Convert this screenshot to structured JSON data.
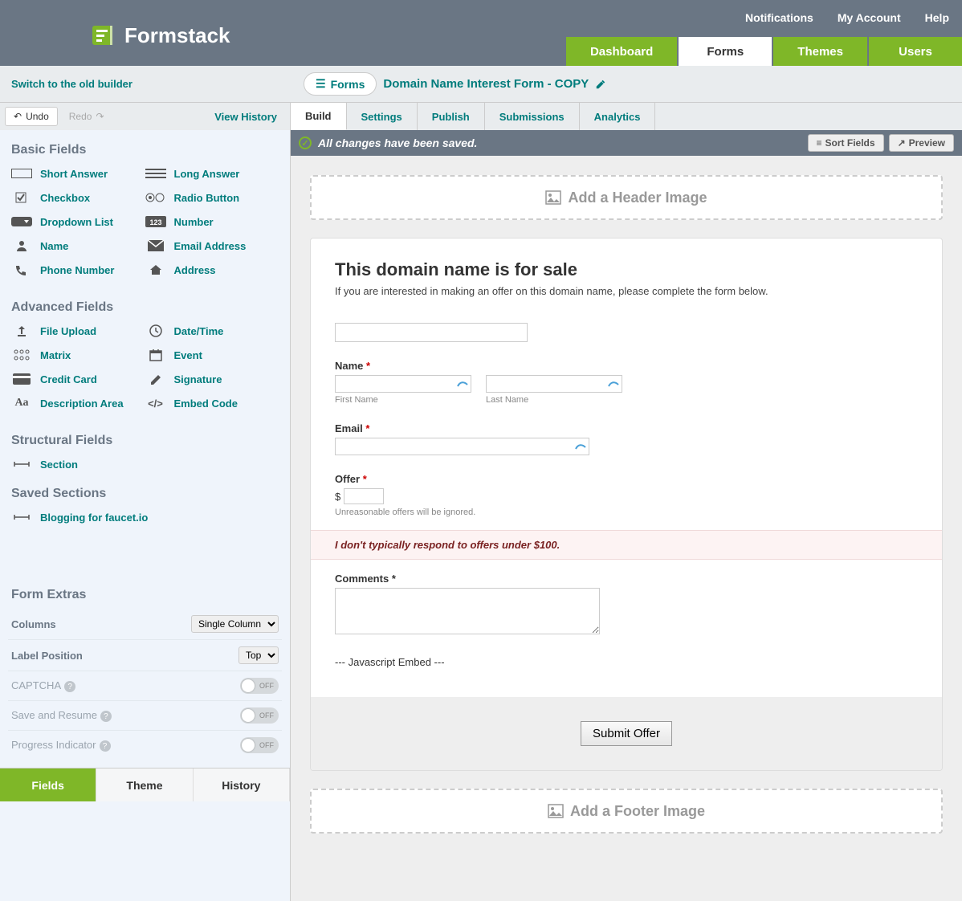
{
  "header": {
    "brand": "Formstack",
    "top_links": [
      "Notifications",
      "My Account",
      "Help"
    ],
    "nav_tabs": [
      "Dashboard",
      "Forms",
      "Themes",
      "Users"
    ],
    "active_nav": "Forms"
  },
  "secondary": {
    "old_builder": "Switch to the old builder",
    "crumb_btn": "Forms",
    "crumb_title": "Domain Name Interest Form - COPY"
  },
  "toolbar": {
    "undo": "Undo",
    "redo": "Redo",
    "view_history": "View History",
    "section_tabs": [
      "Build",
      "Settings",
      "Publish",
      "Submissions",
      "Analytics"
    ],
    "active_section": "Build"
  },
  "sidebar": {
    "basic_title": "Basic Fields",
    "basic_fields": [
      "Short Answer",
      "Long Answer",
      "Checkbox",
      "Radio Button",
      "Dropdown List",
      "Number",
      "Name",
      "Email Address",
      "Phone Number",
      "Address"
    ],
    "advanced_title": "Advanced Fields",
    "advanced_fields": [
      "File Upload",
      "Date/Time",
      "Matrix",
      "Event",
      "Credit Card",
      "Signature",
      "Description Area",
      "Embed Code"
    ],
    "structural_title": "Structural Fields",
    "structural_fields": [
      "Section"
    ],
    "saved_title": "Saved Sections",
    "saved_sections": [
      "Blogging for faucet.io"
    ],
    "extras_title": "Form Extras",
    "extras": {
      "columns_label": "Columns",
      "columns_value": "Single Column",
      "label_pos_label": "Label Position",
      "label_pos_value": "Top",
      "captcha_label": "CAPTCHA",
      "captcha_state": "OFF",
      "save_resume_label": "Save and Resume",
      "save_resume_state": "OFF",
      "progress_label": "Progress Indicator",
      "progress_state": "OFF"
    },
    "bottom_tabs": [
      "Fields",
      "Theme",
      "History"
    ],
    "active_bottom": "Fields"
  },
  "main": {
    "save_msg": "All changes have been saved.",
    "sort_btn": "Sort Fields",
    "preview_btn": "Preview",
    "header_image": "Add a Header Image",
    "footer_image": "Add a Footer Image",
    "form": {
      "title": "This domain name is for sale",
      "intro": "If you are interested in making an offer on this domain name, please complete the form below.",
      "name_label": "Name",
      "first_name": "First Name",
      "last_name": "Last Name",
      "email_label": "Email",
      "offer_label": "Offer",
      "offer_currency": "$",
      "offer_note": "Unreasonable offers will be ignored.",
      "warn": "I don't typically respond to offers under $100.",
      "comments_label": "Comments",
      "comments_req": "*",
      "js_embed": "--- Javascript Embed ---",
      "submit": "Submit Offer"
    }
  }
}
